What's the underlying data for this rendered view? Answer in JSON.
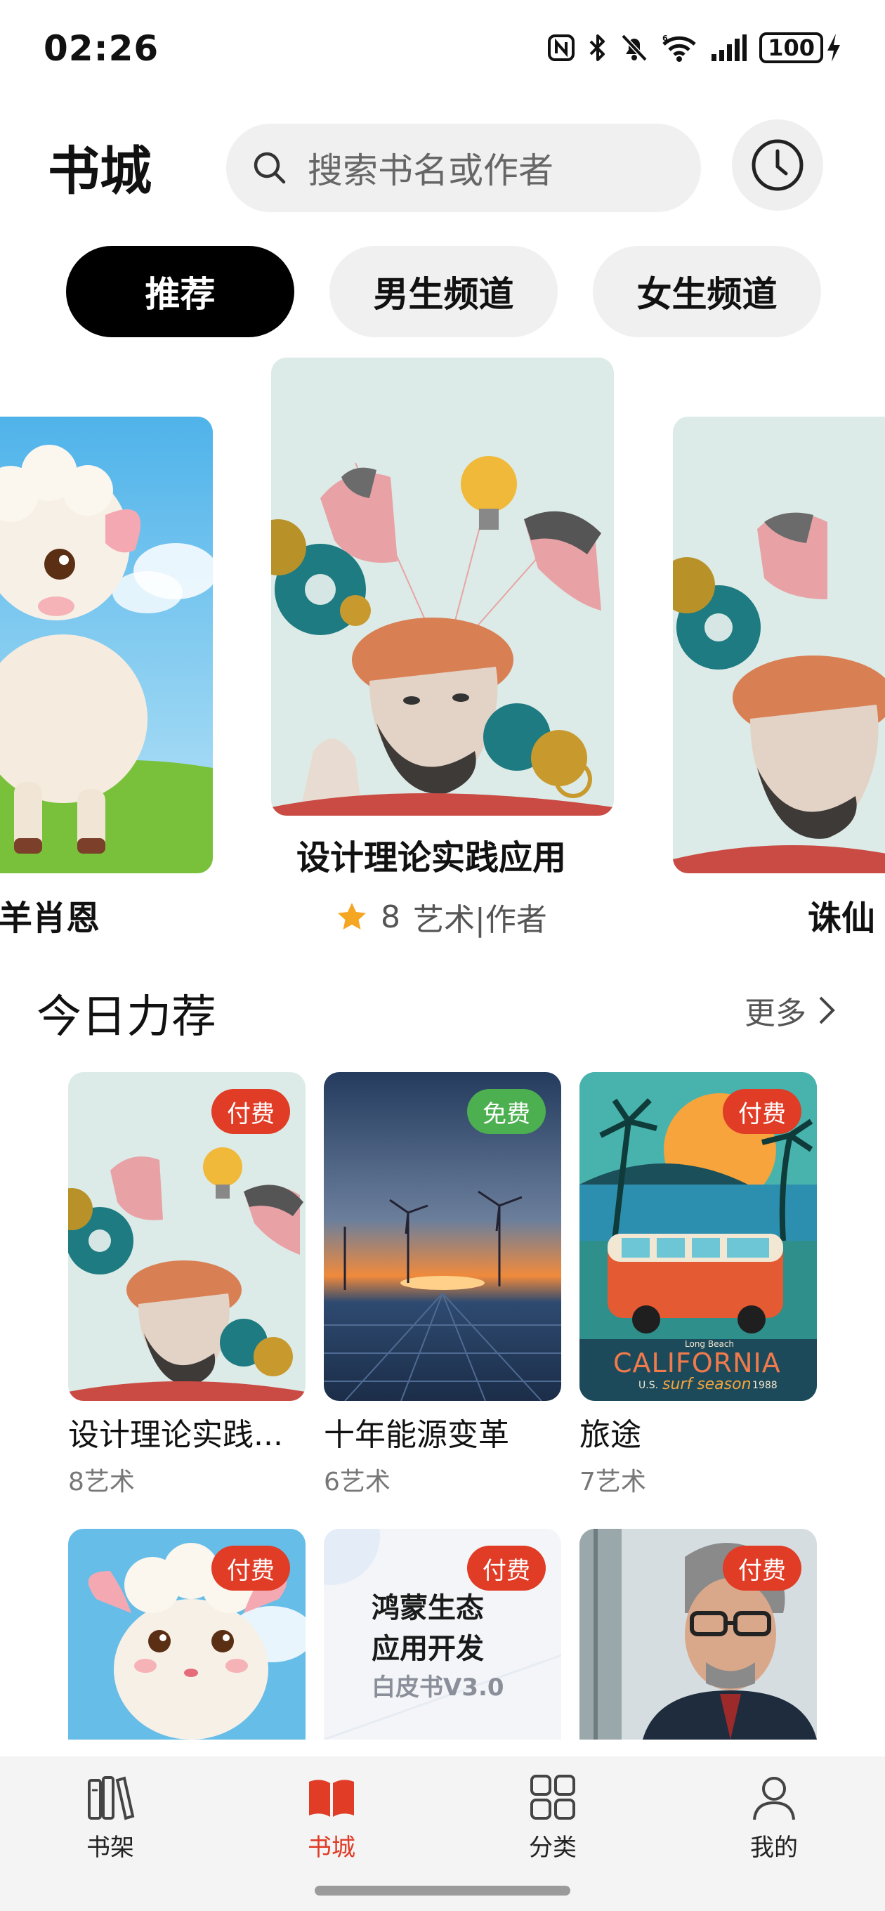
{
  "status_bar": {
    "time": "02:26",
    "battery": "100"
  },
  "header": {
    "title": "书城",
    "search_placeholder": "搜索书名或作者"
  },
  "tabs": [
    {
      "label": "推荐",
      "active": true
    },
    {
      "label": "男生频道",
      "active": false
    },
    {
      "label": "女生频道",
      "active": false
    }
  ],
  "carousel": {
    "left_title": "小羊肖恩",
    "center_title": "设计理论实践应用",
    "center_rating": "8",
    "center_author": "艺术|作者",
    "right_title": "诛仙"
  },
  "section": {
    "title": "今日力荐",
    "more": "更多"
  },
  "books": [
    {
      "title": "设计理论实践...",
      "author": "8艺术",
      "badge": "付费"
    },
    {
      "title": "十年能源变革",
      "author": "6艺术",
      "badge": "免费"
    },
    {
      "title": "旅途",
      "author": "7艺术",
      "badge": "付费"
    },
    {
      "badge": "付费"
    },
    {
      "badge": "付费",
      "cover_line1": "鸿蒙生态",
      "cover_line2": "应用开发",
      "cover_line3": "白皮书V3.0"
    },
    {
      "badge": "付费"
    }
  ],
  "california_cover": {
    "small": "Long Beach",
    "main": "CALIFORNIA",
    "sub": "surf season",
    "year": "1988",
    "us": "U.S."
  },
  "bottom_nav": [
    {
      "label": "书架",
      "icon": "bookshelf-icon"
    },
    {
      "label": "书城",
      "icon": "open-book-icon",
      "active": true
    },
    {
      "label": "分类",
      "icon": "grid-icon"
    },
    {
      "label": "我的",
      "icon": "person-icon"
    }
  ],
  "colors": {
    "accent": "#e03c26",
    "free": "#4caf50",
    "star": "#f5a623"
  }
}
